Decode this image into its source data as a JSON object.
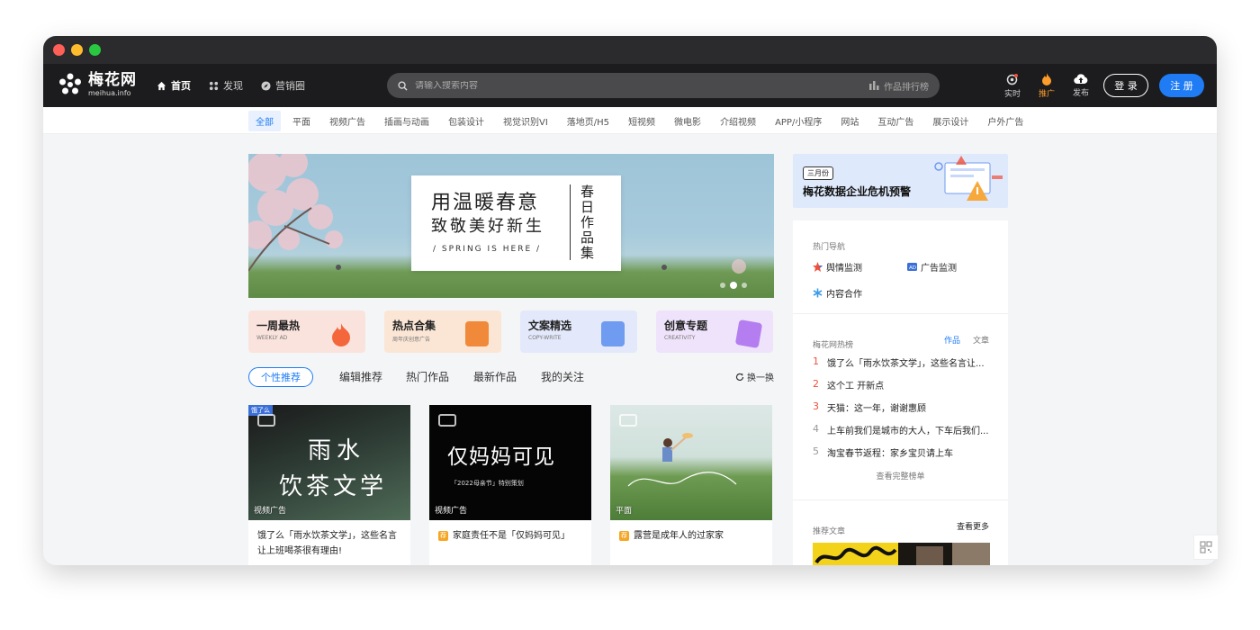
{
  "nav": {
    "logo_cn": "梅花网",
    "logo_en": "meihua.info",
    "links": [
      "首页",
      "发现",
      "营销圈"
    ],
    "search_placeholder": "请输入搜索内容",
    "rank_label": "作品排行榜",
    "realtime": "实时",
    "promote": "推广",
    "publish": "发布",
    "login": "登 录",
    "register": "注 册"
  },
  "categories": [
    "全部",
    "平面",
    "视频广告",
    "插画与动画",
    "包装设计",
    "视觉识别VI",
    "落地页/H5",
    "短视频",
    "微电影",
    "介绍视频",
    "APP/小程序",
    "网站",
    "互动广告",
    "展示设计",
    "户外广告"
  ],
  "banner": {
    "line1": "用温暖春意",
    "line2": "致敬美好新生",
    "line3": "/ SPRING IS HERE /",
    "vertical": "春日作品集"
  },
  "tiles": [
    {
      "title": "一周最热",
      "sub": "WEEKLY AD",
      "color": "#fbe3dd",
      "accent": "#f4663b"
    },
    {
      "title": "热点合集",
      "sub": "周年庆创意广告",
      "color": "#fbe6d6",
      "accent": "#f08a3a"
    },
    {
      "title": "文案精选",
      "sub": "COPY-WRITE",
      "color": "#e3e9fb",
      "accent": "#6f9bf0"
    },
    {
      "title": "创意专题",
      "sub": "CREATIVITY",
      "color": "#efe3fb",
      "accent": "#b57ef0"
    }
  ],
  "tabs": [
    "个性推荐",
    "编辑推荐",
    "热门作品",
    "最新作品",
    "我的关注"
  ],
  "refresh": "换一换",
  "cards": [
    {
      "tag": "视频广告",
      "title": "饿了么「雨水饮茶文学」，这些名言让上班喝茶很有理由!",
      "art1": "雨水",
      "art2": "饮茶文学",
      "corner": "饿了么"
    },
    {
      "tag": "视频广告",
      "title": "家庭责任不是「仅妈妈可见」",
      "art1": "仅妈妈可见",
      "art2": "「2022母亲节」特别策划",
      "corner": ""
    },
    {
      "tag": "平面",
      "title": "露营是成年人的过家家",
      "art1": "",
      "art2": "",
      "corner": ""
    }
  ],
  "promo": {
    "badge": "三月份",
    "title": "梅花数据企业危机预警"
  },
  "hot_nav": {
    "title": "热门导航",
    "items": [
      "舆情监测",
      "广告监测",
      "内容合作"
    ]
  },
  "ranking": {
    "title": "梅花网热榜",
    "tab_works": "作品",
    "tab_articles": "文章",
    "items": [
      {
        "num": "1",
        "text": "饿了么「雨水饮茶文学」，这些名言让..."
      },
      {
        "num": "2",
        "text": "这个工 开新点"
      },
      {
        "num": "3",
        "text": "天猫：这一年，谢谢惠顾"
      },
      {
        "num": "4",
        "text": "上车前我们是城市的大人，下车后我们..."
      },
      {
        "num": "5",
        "text": "淘宝春节返程：家乡宝贝请上车"
      }
    ],
    "more": "查看完整榜单"
  },
  "recommend": {
    "title": "推荐文章",
    "more": "查看更多"
  },
  "colors": {
    "accent": "#1f7cf5",
    "nav_bg": "#1c1c1e",
    "hot": "#f0503a"
  }
}
